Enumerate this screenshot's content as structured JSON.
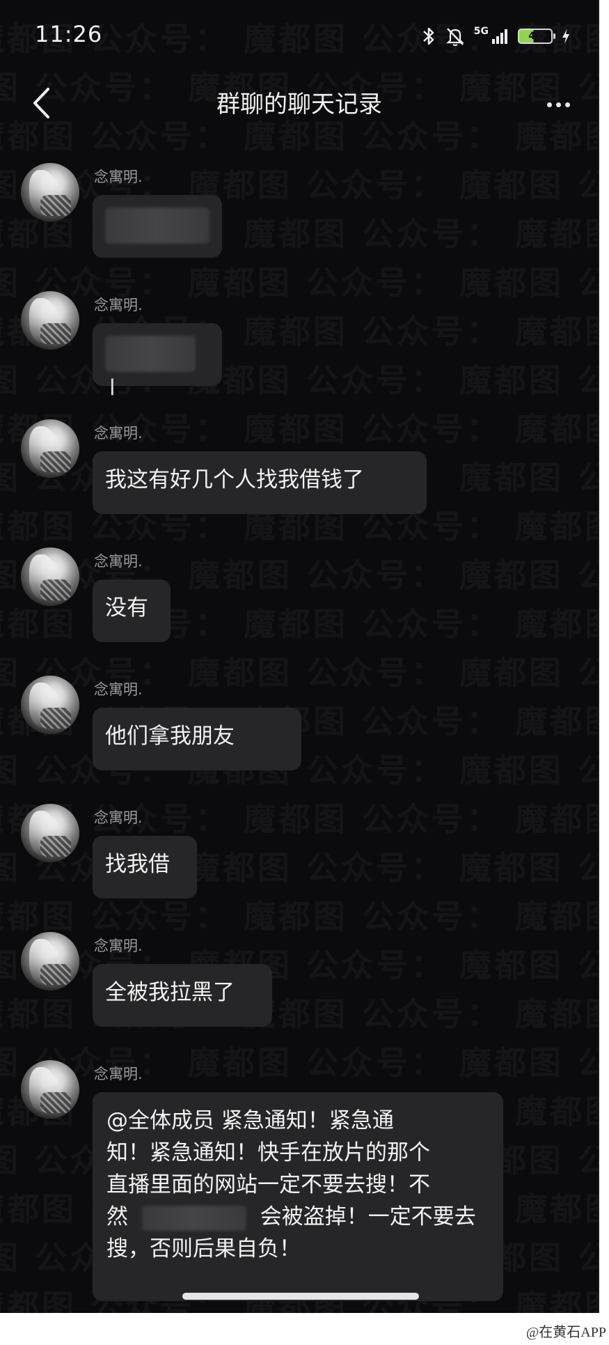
{
  "status_bar": {
    "time": "11:26",
    "network": "5G",
    "battery_level": "45",
    "battery_fill": 0.45
  },
  "nav": {
    "title": "群聊的聊天记录",
    "back_icon": "chevron-left-icon",
    "more_icon": "more-dots-icon"
  },
  "watermark": "魔都图  公众号：",
  "messages": [
    {
      "sender": "念寓明.",
      "text": "",
      "redacted": true
    },
    {
      "sender": "念寓明.",
      "text": "",
      "redacted": true,
      "suffix": "l"
    },
    {
      "sender": "念寓明.",
      "text": "我这有好几个人找我借钱了"
    },
    {
      "sender": "念寓明.",
      "text": "没有"
    },
    {
      "sender": "念寓明.",
      "text": "他们拿我朋友"
    },
    {
      "sender": "念寓明.",
      "text": "找我借"
    },
    {
      "sender": "念寓明.",
      "text": "全被我拉黑了"
    },
    {
      "sender": "念寓明.",
      "lines": [
        "@全体成员  紧急通知！紧急通",
        "知！紧急通知！快手在放片的那个",
        "直播里面的网站一定不要去搜！不",
        "然",
        "会被盗掉！一定不要去",
        "搜，否则后果自负！"
      ]
    }
  ],
  "credit": "@在黄石APP"
}
